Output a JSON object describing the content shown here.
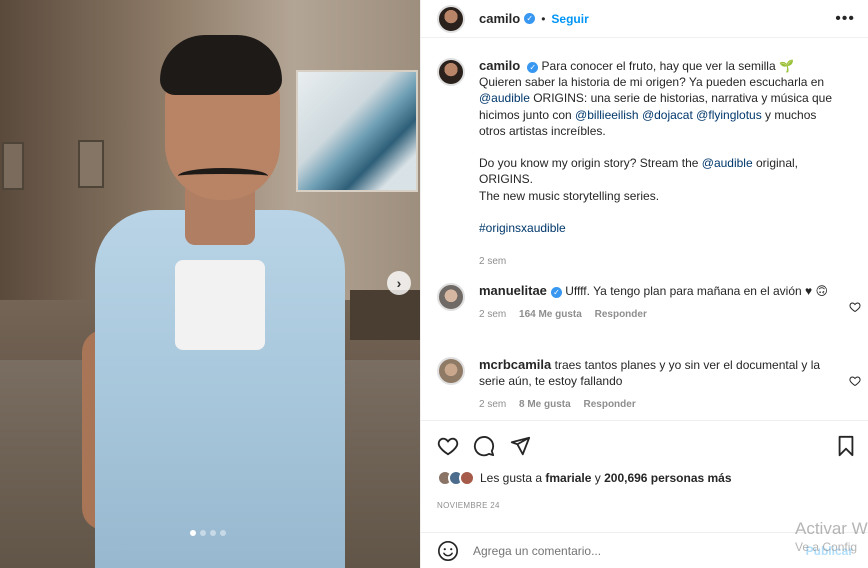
{
  "header": {
    "username": "camilo",
    "follow_label": "Seguir",
    "more_label": "•••"
  },
  "caption": {
    "username": "camilo",
    "line1": "Para conocer el fruto, hay que ver la semilla 🌱",
    "line2": "Quieren saber la historia de mi origen? Ya pueden escucharla en",
    "mention_audible": "@audible",
    "line3": " ORIGINS: una serie de historias, narrativa y música que hicimos junto con ",
    "mention_billie": "@billieeilish",
    "mention_doja": "@dojacat",
    "mention_flying": "@flyinglotus",
    "line4": " y muchos otros artistas increíbles.",
    "en_line1": "Do you know my origin story? Stream the ",
    "en_mention": "@audible",
    "en_line1b": " original, ORIGINS.",
    "en_line2": "The new music storytelling series.",
    "hashtag": "#originsxaudible",
    "time": "2 sem"
  },
  "comments": [
    {
      "username": "manuelitae",
      "text": "Uffff. Ya tengo plan para mañana en el avión ♥ 🙃",
      "time": "2 sem",
      "likes": "164 Me gusta",
      "reply": "Responder"
    },
    {
      "username": "mcrbcamila",
      "text": "traes tantos planes y yo sin ver el documental y la serie aún, te estoy fallando",
      "time": "2 sem",
      "likes": "8 Me gusta",
      "reply": "Responder"
    }
  ],
  "likes": {
    "prefix": "Les gusta a ",
    "user": "fmariale",
    "middle": " y ",
    "count": "200,696 personas más"
  },
  "date": "NOVIEMBRE 24",
  "comment_bar": {
    "placeholder": "Agrega un comentario...",
    "publish": "Publicar"
  },
  "watermark": {
    "title": "Activar W",
    "sub": "Ve a Config"
  },
  "colors": {
    "accent": "#0095f6",
    "mention": "#00376b",
    "verified": "#3897f0",
    "muted": "#8e8e8e"
  },
  "carousel": {
    "slides": 4,
    "active": 1
  }
}
